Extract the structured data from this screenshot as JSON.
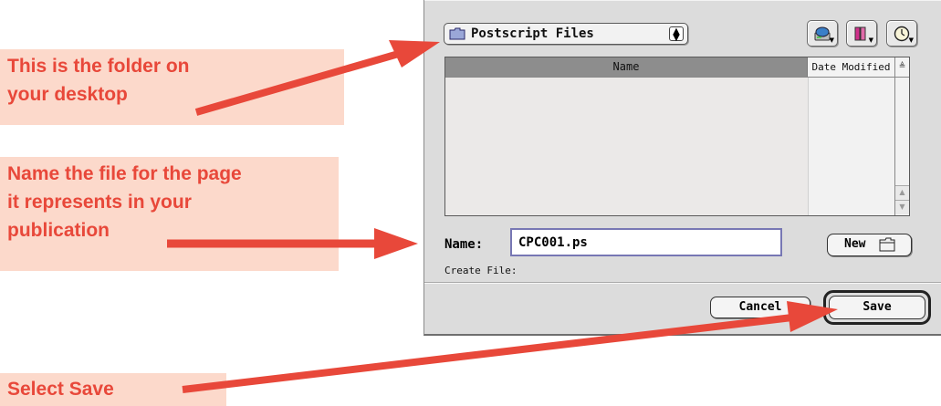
{
  "callouts": {
    "folder": [
      "This is the folder on",
      "your desktop"
    ],
    "name_file": [
      "Name the file for the page",
      "it represents in your",
      "publication"
    ],
    "select_save": "Select Save"
  },
  "dialog": {
    "folder_popup": {
      "label": "Postscript Files",
      "icon": "folder-icon"
    },
    "toolbar": [
      {
        "name": "shortcuts-button",
        "icon": "disk-icon"
      },
      {
        "name": "favorites-button",
        "icon": "favorites-book-icon"
      },
      {
        "name": "recent-button",
        "icon": "clock-icon"
      }
    ],
    "file_list": {
      "columns": {
        "name": "Name",
        "date_modified": "Date Modified"
      },
      "sort_indicator_icon": "sort-order-icon",
      "rows": []
    },
    "name_label": "Name:",
    "name_value": "CPC001.ps",
    "new_button": {
      "label": "New",
      "icon": "new-folder-icon"
    },
    "create_label": "Create File:",
    "cancel_label": "Cancel",
    "save_label": "Save"
  },
  "colors": {
    "callout_text": "#e8483a",
    "callout_bg": "#fcd9cb",
    "arrow": "#e8483a",
    "dialog_bg": "#dcdcdc",
    "list_header_selected": "#8d8d8d"
  }
}
